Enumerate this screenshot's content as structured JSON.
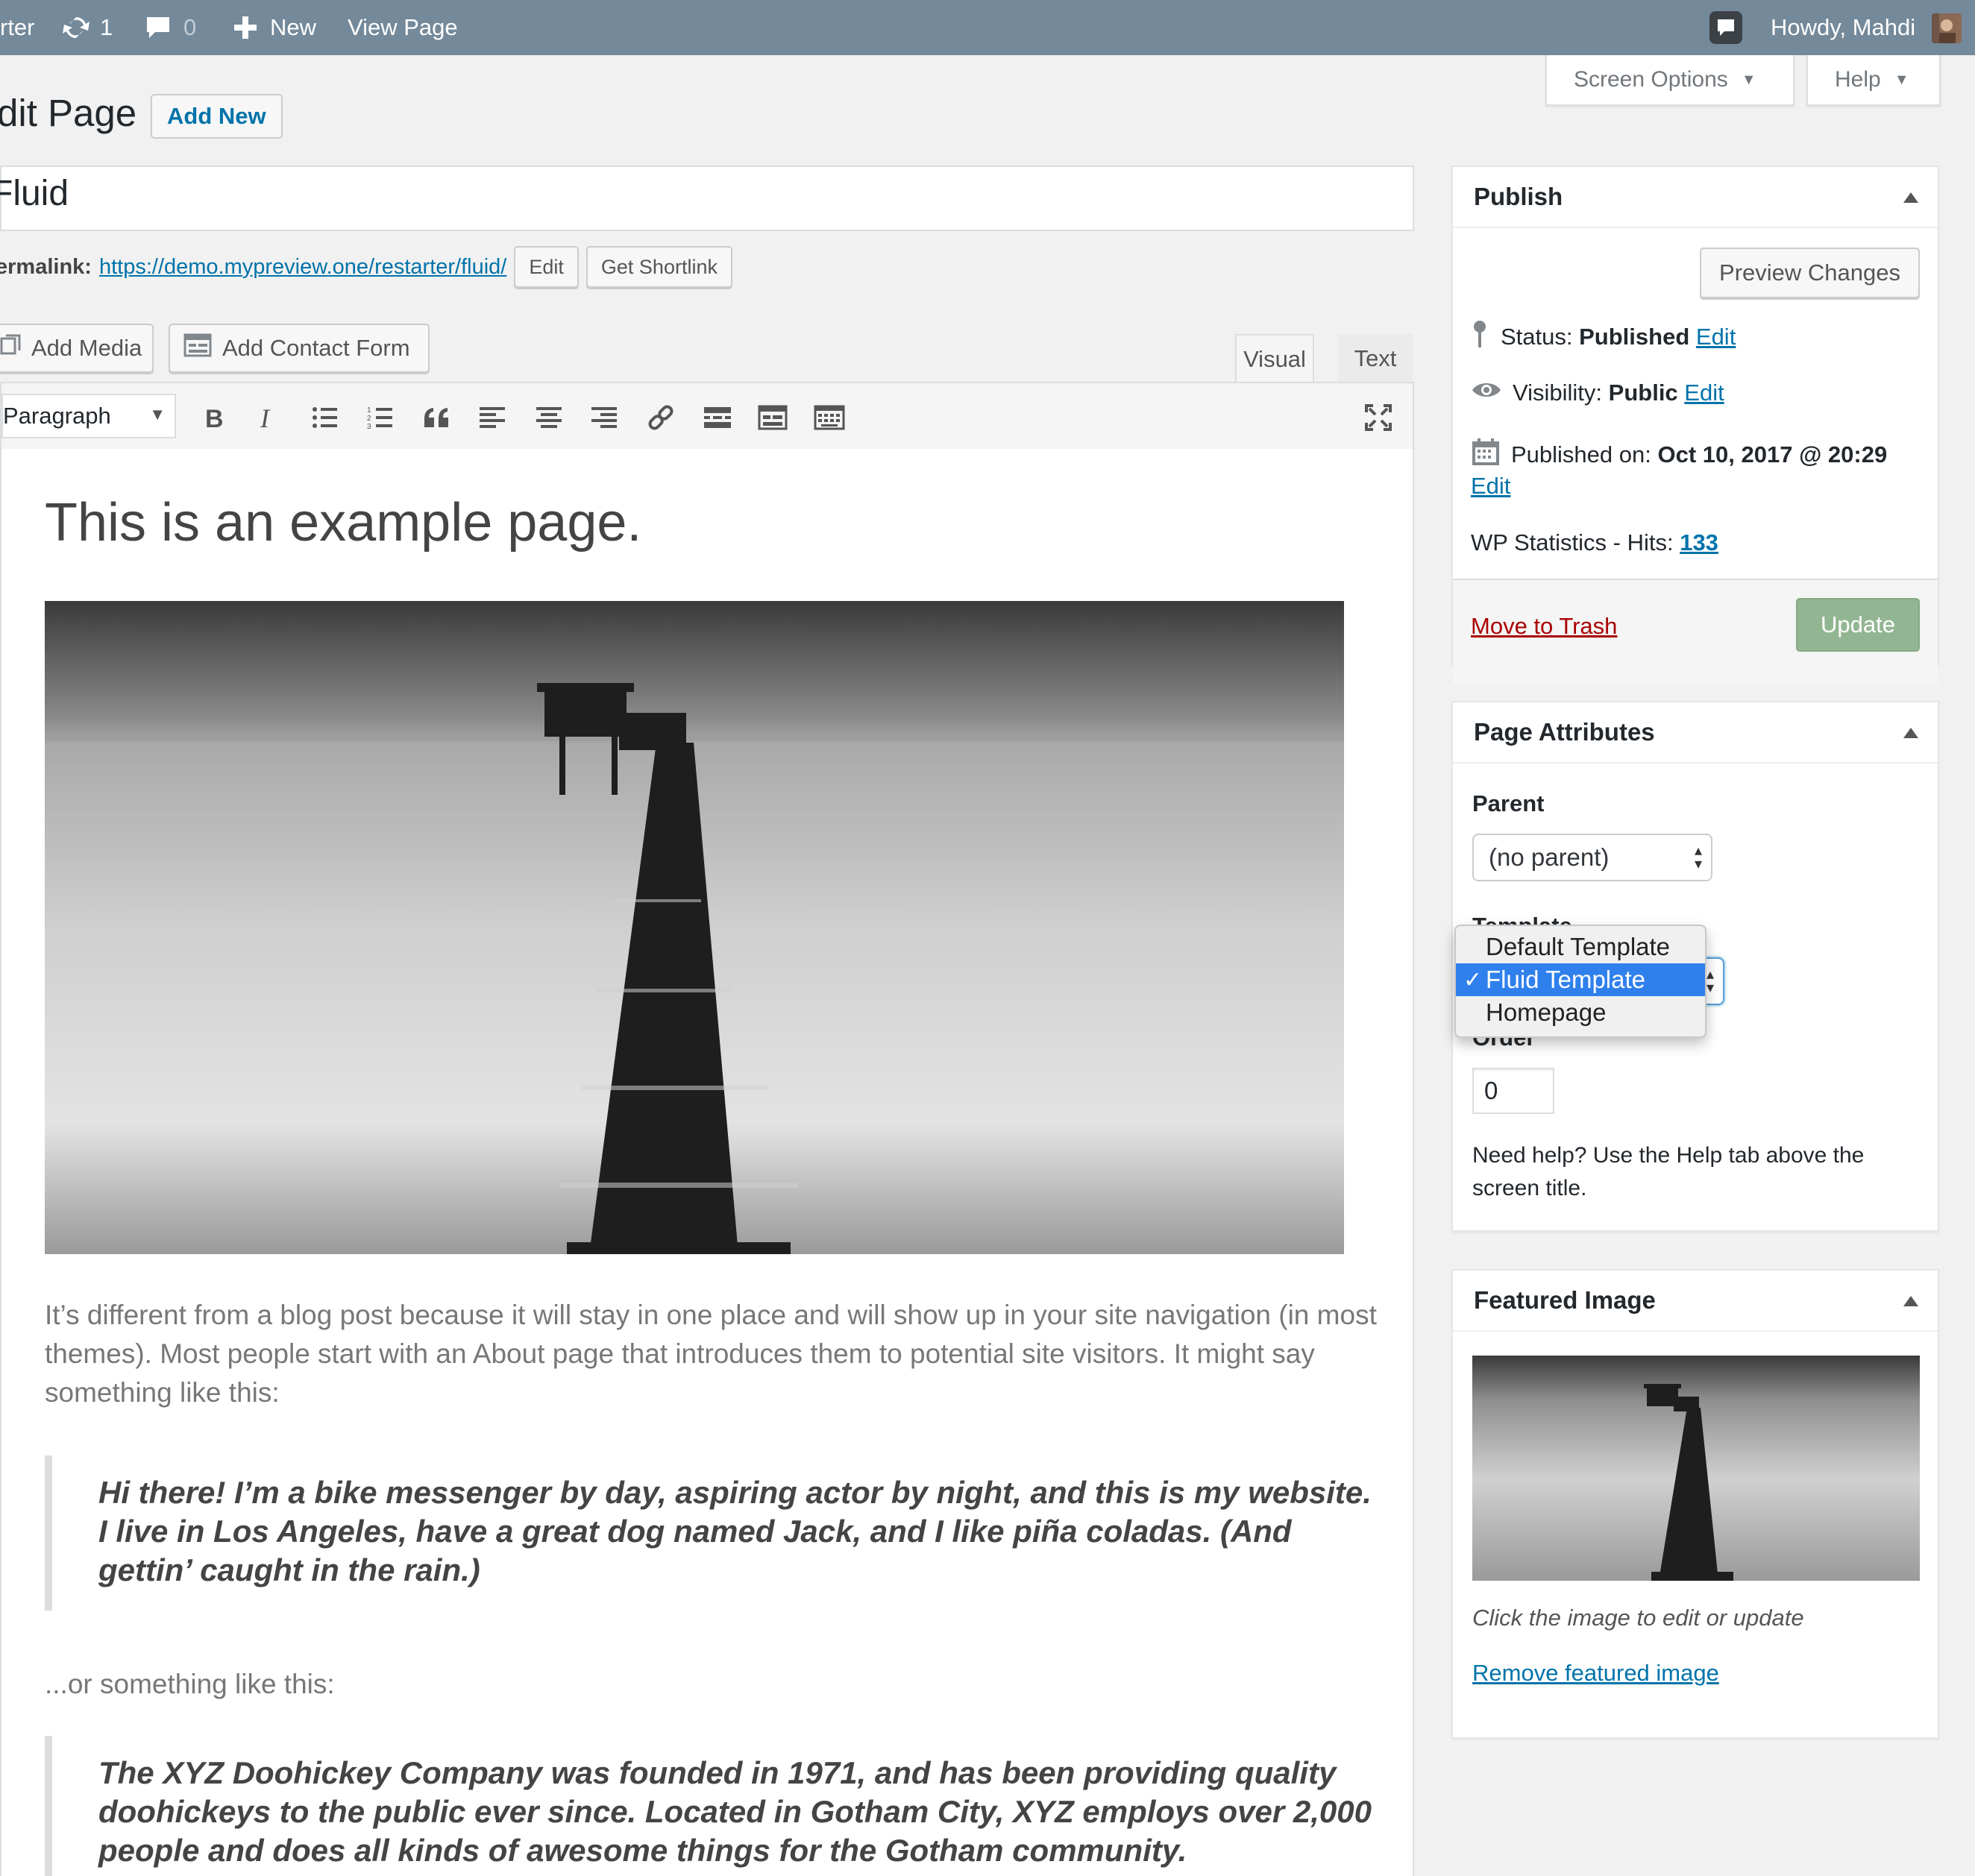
{
  "admin_bar": {
    "site_label": "rter",
    "updates_count": "1",
    "comments_count": "0",
    "new_label": "New",
    "view_page_label": "View Page",
    "howdy": "Howdy, Mahdi"
  },
  "screen_meta": {
    "screen_options": "Screen Options",
    "help": "Help"
  },
  "heading": {
    "title": "dit Page",
    "add_new": "Add New"
  },
  "post": {
    "title": "Fluid",
    "permalink_label": "ermalink:",
    "permalink_url": "https://demo.mypreview.one/restarter/fluid/",
    "edit_button": "Edit",
    "shortlink_button": "Get Shortlink"
  },
  "media_buttons": {
    "add_media": "Add Media",
    "add_contact_form": "Add Contact Form"
  },
  "editor_tabs": {
    "visual": "Visual",
    "text": "Text"
  },
  "toolbar": {
    "format_select": "Paragraph"
  },
  "content": {
    "heading": "This is an example page.",
    "paragraph": "It’s different from a blog post because it will stay in one place and will show up in your site navigation (in most themes). Most people start with an About page that introduces them to potential site visitors. It might say something like this:",
    "quote1": "Hi there! I’m a bike messenger by day, aspiring actor by night, and this is my website. I live in Los Angeles, have a great dog named Jack, and I like piña coladas. (And gettin’ caught in the rain.)",
    "or_text": "...or something like this:",
    "quote2": "The XYZ Doohickey Company was founded in 1971, and has been providing quality doohickeys to the public ever since. Located in Gotham City, XYZ employs over 2,000 people and does all kinds of awesome things for the Gotham community."
  },
  "publish": {
    "title": "Publish",
    "preview_changes": "Preview Changes",
    "status_label": "Status:",
    "status_value": "Published",
    "visibility_label": "Visibility:",
    "visibility_value": "Public",
    "published_on_label": "Published on:",
    "published_on_value": "Oct 10, 2017 @ 20:29",
    "edit_link": "Edit",
    "stats_label": "WP Statistics - Hits:",
    "stats_value": "133",
    "move_to_trash": "Move to Trash",
    "update": "Update"
  },
  "page_attributes": {
    "title": "Page Attributes",
    "parent_label": "Parent",
    "parent_value": "(no parent)",
    "template_label": "Template",
    "template_options": [
      "Default Template",
      "Fluid Template",
      "Homepage"
    ],
    "template_selected": "Fluid Template",
    "order_label": "Order",
    "order_value": "0",
    "help_text": "Need help? Use the Help tab above the screen title."
  },
  "featured_image": {
    "title": "Featured Image",
    "hint": "Click the image to edit or update",
    "remove": "Remove featured image"
  },
  "colors": {
    "admin_bar": "#74899a",
    "link": "#0073aa",
    "trash": "#aa0000",
    "update_button": "#93b692",
    "dropdown_highlight": "#2f80ed"
  }
}
